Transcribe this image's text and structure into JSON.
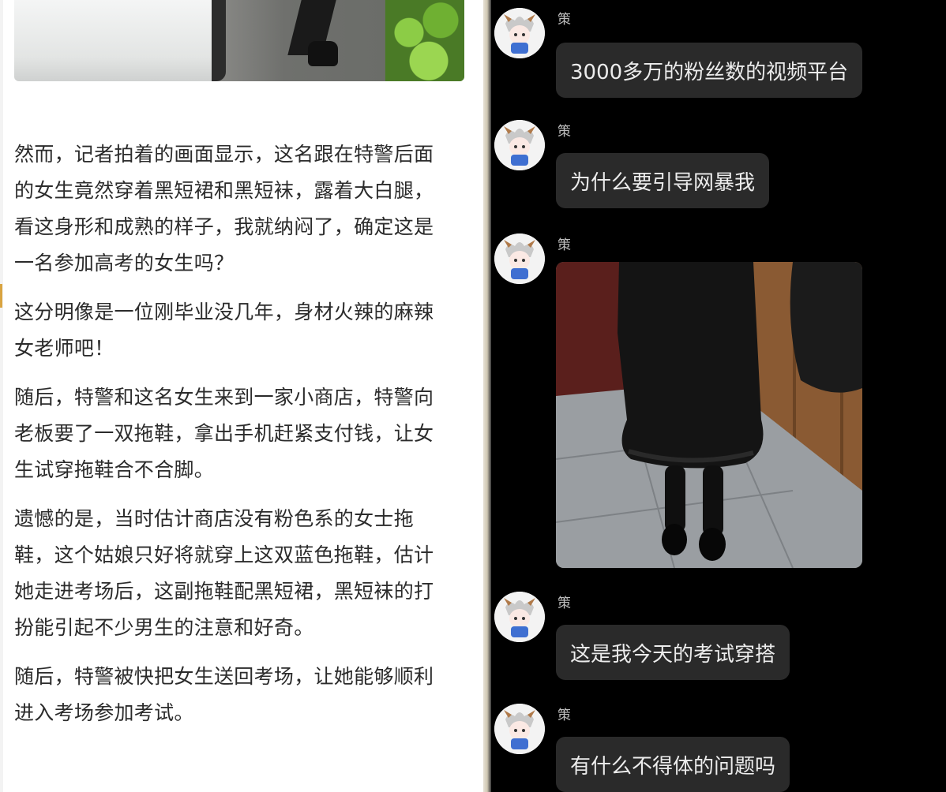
{
  "article": {
    "paragraphs": [
      {
        "lines": [
          "然而，记者拍着的画面显示，这名跟在特警后面",
          "的女生竟然穿着黑短裙和黑短袜，露着大白腿，",
          "看这身形和成熟的样子，我就纳闷了，确定这是",
          "一名参加高考的女生吗？"
        ]
      },
      {
        "lines": [
          "这分明像是一位刚毕业没几年，身材火辣的麻辣",
          "女老师吧！"
        ]
      },
      {
        "lines": [
          "随后，特警和这名女生来到一家小商店，特警向",
          "老板要了一双拖鞋，拿出手机赶紧支付钱，让女",
          "生试穿拖鞋合不合脚。"
        ]
      },
      {
        "lines": [
          "遗憾的是，当时估计商店没有粉色系的女士拖",
          "鞋，这个姑娘只好将就穿上这双蓝色拖鞋，估计",
          "她走进考场后，这副拖鞋配黑短裙，黑短袜的打",
          "扮能引起不少男生的注意和好奇。"
        ]
      },
      {
        "lines": [
          "随后，特警被快把女生送回考场，让她能够顺利",
          "进入考场参加考试。"
        ]
      }
    ]
  },
  "chat": {
    "messages": [
      {
        "sender": "策",
        "text": "3000多万的粉丝数的视频平台"
      },
      {
        "sender": "策",
        "text": "为什么要引导网暴我"
      },
      {
        "sender": "策",
        "image": "photo-of-outfit"
      },
      {
        "sender": "策",
        "text": "这是我今天的考试穿搭"
      },
      {
        "sender": "策",
        "text": "有什么不得体的问题吗"
      }
    ]
  },
  "colors": {
    "chat_background": "#000000",
    "bubble_background": "#2a2a2a",
    "bubble_text": "#ececec",
    "article_text": "#2b2b2b"
  }
}
